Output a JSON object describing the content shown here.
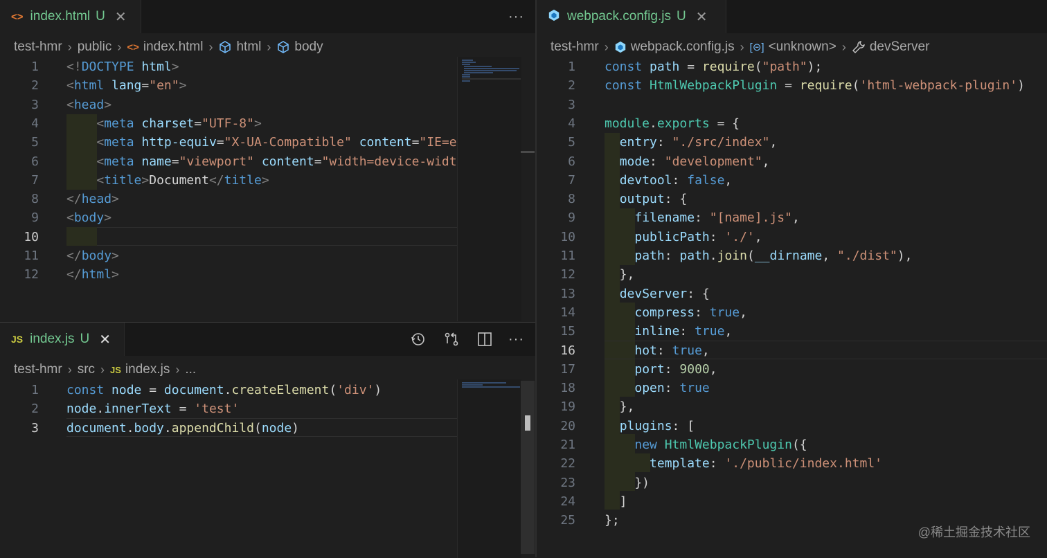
{
  "left_top": {
    "tab": {
      "icon": "<>",
      "label": "index.html",
      "status": "U"
    },
    "breadcrumb": [
      "test-hmr",
      "public",
      "index.html",
      "html",
      "body"
    ],
    "lines": [
      {
        "n": "1",
        "tokens": [
          [
            "t-punc",
            "<!"
          ],
          [
            "t-tag",
            "DOCTYPE"
          ],
          [
            "t-txt",
            " "
          ],
          [
            "t-attr",
            "html"
          ],
          [
            "t-punc",
            ">"
          ]
        ]
      },
      {
        "n": "2",
        "tokens": [
          [
            "t-punc",
            "<"
          ],
          [
            "t-tag",
            "html"
          ],
          [
            "t-txt",
            " "
          ],
          [
            "t-attr",
            "lang"
          ],
          [
            "t-txt",
            "="
          ],
          [
            "t-str",
            "\"en\""
          ],
          [
            "t-punc",
            ">"
          ]
        ]
      },
      {
        "n": "3",
        "tokens": [
          [
            "t-punc",
            "<"
          ],
          [
            "t-tag",
            "head"
          ],
          [
            "t-punc",
            ">"
          ]
        ]
      },
      {
        "n": "4",
        "tokens": [
          [
            "t-txt",
            "    "
          ],
          [
            "t-punc",
            "<"
          ],
          [
            "t-tag",
            "meta"
          ],
          [
            "t-txt",
            " "
          ],
          [
            "t-attr",
            "charset"
          ],
          [
            "t-txt",
            "="
          ],
          [
            "t-str",
            "\"UTF-8\""
          ],
          [
            "t-punc",
            ">"
          ]
        ]
      },
      {
        "n": "5",
        "tokens": [
          [
            "t-txt",
            "    "
          ],
          [
            "t-punc",
            "<"
          ],
          [
            "t-tag",
            "meta"
          ],
          [
            "t-txt",
            " "
          ],
          [
            "t-attr",
            "http-equiv"
          ],
          [
            "t-txt",
            "="
          ],
          [
            "t-str",
            "\"X-UA-Compatible\""
          ],
          [
            "t-txt",
            " "
          ],
          [
            "t-attr",
            "content"
          ],
          [
            "t-txt",
            "="
          ],
          [
            "t-str",
            "\"IE=e"
          ]
        ]
      },
      {
        "n": "6",
        "tokens": [
          [
            "t-txt",
            "    "
          ],
          [
            "t-punc",
            "<"
          ],
          [
            "t-tag",
            "meta"
          ],
          [
            "t-txt",
            " "
          ],
          [
            "t-attr",
            "name"
          ],
          [
            "t-txt",
            "="
          ],
          [
            "t-str",
            "\"viewport\""
          ],
          [
            "t-txt",
            " "
          ],
          [
            "t-attr",
            "content"
          ],
          [
            "t-txt",
            "="
          ],
          [
            "t-str",
            "\"width=device-widt"
          ]
        ]
      },
      {
        "n": "7",
        "tokens": [
          [
            "t-txt",
            "    "
          ],
          [
            "t-punc",
            "<"
          ],
          [
            "t-tag",
            "title"
          ],
          [
            "t-punc",
            ">"
          ],
          [
            "t-txt",
            "Document"
          ],
          [
            "t-punc",
            "</"
          ],
          [
            "t-tag",
            "title"
          ],
          [
            "t-punc",
            ">"
          ]
        ]
      },
      {
        "n": "8",
        "tokens": [
          [
            "t-punc",
            "</"
          ],
          [
            "t-tag",
            "head"
          ],
          [
            "t-punc",
            ">"
          ]
        ]
      },
      {
        "n": "9",
        "tokens": [
          [
            "t-punc",
            "<"
          ],
          [
            "t-tag",
            "body"
          ],
          [
            "t-punc",
            ">"
          ]
        ]
      },
      {
        "n": "10",
        "tokens": []
      },
      {
        "n": "11",
        "tokens": [
          [
            "t-punc",
            "</"
          ],
          [
            "t-tag",
            "body"
          ],
          [
            "t-punc",
            ">"
          ]
        ]
      },
      {
        "n": "12",
        "tokens": [
          [
            "t-punc",
            "</"
          ],
          [
            "t-tag",
            "html"
          ],
          [
            "t-punc",
            ">"
          ]
        ]
      }
    ],
    "active_line": "10"
  },
  "left_bottom": {
    "tab": {
      "icon": "JS",
      "label": "index.js",
      "status": "U"
    },
    "breadcrumb": [
      "test-hmr",
      "src",
      "index.js",
      "..."
    ],
    "lines": [
      {
        "n": "1",
        "tokens": [
          [
            "t-kw",
            "const"
          ],
          [
            "t-plain",
            " "
          ],
          [
            "t-var",
            "node"
          ],
          [
            "t-plain",
            " = "
          ],
          [
            "t-var",
            "document"
          ],
          [
            "t-plain",
            "."
          ],
          [
            "t-fn",
            "createElement"
          ],
          [
            "t-plain",
            "("
          ],
          [
            "t-str",
            "'div'"
          ],
          [
            "t-plain",
            ")"
          ]
        ]
      },
      {
        "n": "2",
        "tokens": [
          [
            "t-var",
            "node"
          ],
          [
            "t-plain",
            "."
          ],
          [
            "t-var",
            "innerText"
          ],
          [
            "t-plain",
            " = "
          ],
          [
            "t-str",
            "'test'"
          ]
        ]
      },
      {
        "n": "3",
        "tokens": [
          [
            "t-var",
            "document"
          ],
          [
            "t-plain",
            "."
          ],
          [
            "t-var",
            "body"
          ],
          [
            "t-plain",
            "."
          ],
          [
            "t-fn",
            "appendChild"
          ],
          [
            "t-plain",
            "("
          ],
          [
            "t-var",
            "node"
          ],
          [
            "t-plain",
            ")"
          ]
        ]
      }
    ],
    "active_line": "3"
  },
  "right": {
    "tab": {
      "icon": "webpack",
      "label": "webpack.config.js",
      "status": "U"
    },
    "breadcrumb": [
      "test-hmr",
      "webpack.config.js",
      "<unknown>",
      "devServer"
    ],
    "lines": [
      {
        "n": "1",
        "tokens": [
          [
            "t-kw",
            "const"
          ],
          [
            "t-plain",
            " "
          ],
          [
            "t-var",
            "path"
          ],
          [
            "t-plain",
            " = "
          ],
          [
            "t-fn",
            "require"
          ],
          [
            "t-plain",
            "("
          ],
          [
            "t-str",
            "\"path\""
          ],
          [
            "t-plain",
            ");"
          ]
        ]
      },
      {
        "n": "2",
        "tokens": [
          [
            "t-kw",
            "const"
          ],
          [
            "t-plain",
            " "
          ],
          [
            "t-cls",
            "HtmlWebpackPlugin"
          ],
          [
            "t-plain",
            " = "
          ],
          [
            "t-fn",
            "require"
          ],
          [
            "t-plain",
            "("
          ],
          [
            "t-str",
            "'html-webpack-plugin'"
          ],
          [
            "t-plain",
            ")"
          ]
        ]
      },
      {
        "n": "3",
        "tokens": []
      },
      {
        "n": "4",
        "tokens": [
          [
            "t-cls",
            "module"
          ],
          [
            "t-plain",
            "."
          ],
          [
            "t-cls",
            "exports"
          ],
          [
            "t-plain",
            " = {"
          ]
        ]
      },
      {
        "n": "5",
        "tokens": [
          [
            "t-plain",
            "  "
          ],
          [
            "t-var",
            "entry"
          ],
          [
            "t-plain",
            ": "
          ],
          [
            "t-str",
            "\"./src/index\""
          ],
          [
            "t-plain",
            ","
          ]
        ]
      },
      {
        "n": "6",
        "tokens": [
          [
            "t-plain",
            "  "
          ],
          [
            "t-var",
            "mode"
          ],
          [
            "t-plain",
            ": "
          ],
          [
            "t-str",
            "\"development\""
          ],
          [
            "t-plain",
            ","
          ]
        ]
      },
      {
        "n": "7",
        "tokens": [
          [
            "t-plain",
            "  "
          ],
          [
            "t-var",
            "devtool"
          ],
          [
            "t-plain",
            ": "
          ],
          [
            "t-bool",
            "false"
          ],
          [
            "t-plain",
            ","
          ]
        ]
      },
      {
        "n": "8",
        "tokens": [
          [
            "t-plain",
            "  "
          ],
          [
            "t-var",
            "output"
          ],
          [
            "t-plain",
            ": {"
          ]
        ]
      },
      {
        "n": "9",
        "tokens": [
          [
            "t-plain",
            "    "
          ],
          [
            "t-var",
            "filename"
          ],
          [
            "t-plain",
            ": "
          ],
          [
            "t-str",
            "\"[name].js\""
          ],
          [
            "t-plain",
            ","
          ]
        ]
      },
      {
        "n": "10",
        "tokens": [
          [
            "t-plain",
            "    "
          ],
          [
            "t-var",
            "publicPath"
          ],
          [
            "t-plain",
            ": "
          ],
          [
            "t-str",
            "'./'"
          ],
          [
            "t-plain",
            ","
          ]
        ]
      },
      {
        "n": "11",
        "tokens": [
          [
            "t-plain",
            "    "
          ],
          [
            "t-var",
            "path"
          ],
          [
            "t-plain",
            ": "
          ],
          [
            "t-var",
            "path"
          ],
          [
            "t-plain",
            "."
          ],
          [
            "t-fn",
            "join"
          ],
          [
            "t-plain",
            "("
          ],
          [
            "t-var",
            "__dirname"
          ],
          [
            "t-plain",
            ", "
          ],
          [
            "t-str",
            "\"./dist\""
          ],
          [
            "t-plain",
            "),"
          ]
        ]
      },
      {
        "n": "12",
        "tokens": [
          [
            "t-plain",
            "  },"
          ]
        ]
      },
      {
        "n": "13",
        "tokens": [
          [
            "t-plain",
            "  "
          ],
          [
            "t-var",
            "devServer"
          ],
          [
            "t-plain",
            ": {"
          ]
        ]
      },
      {
        "n": "14",
        "tokens": [
          [
            "t-plain",
            "    "
          ],
          [
            "t-var",
            "compress"
          ],
          [
            "t-plain",
            ": "
          ],
          [
            "t-bool",
            "true"
          ],
          [
            "t-plain",
            ","
          ]
        ]
      },
      {
        "n": "15",
        "tokens": [
          [
            "t-plain",
            "    "
          ],
          [
            "t-var",
            "inline"
          ],
          [
            "t-plain",
            ": "
          ],
          [
            "t-bool",
            "true"
          ],
          [
            "t-plain",
            ","
          ]
        ]
      },
      {
        "n": "16",
        "tokens": [
          [
            "t-plain",
            "    "
          ],
          [
            "t-var",
            "hot"
          ],
          [
            "t-plain",
            ": "
          ],
          [
            "t-bool",
            "true"
          ],
          [
            "t-plain",
            ","
          ]
        ]
      },
      {
        "n": "17",
        "tokens": [
          [
            "t-plain",
            "    "
          ],
          [
            "t-var",
            "port"
          ],
          [
            "t-plain",
            ": "
          ],
          [
            "t-num",
            "9000"
          ],
          [
            "t-plain",
            ","
          ]
        ]
      },
      {
        "n": "18",
        "tokens": [
          [
            "t-plain",
            "    "
          ],
          [
            "t-var",
            "open"
          ],
          [
            "t-plain",
            ": "
          ],
          [
            "t-bool",
            "true"
          ]
        ]
      },
      {
        "n": "19",
        "tokens": [
          [
            "t-plain",
            "  },"
          ]
        ]
      },
      {
        "n": "20",
        "tokens": [
          [
            "t-plain",
            "  "
          ],
          [
            "t-var",
            "plugins"
          ],
          [
            "t-plain",
            ": ["
          ]
        ]
      },
      {
        "n": "21",
        "tokens": [
          [
            "t-plain",
            "    "
          ],
          [
            "t-kw",
            "new"
          ],
          [
            "t-plain",
            " "
          ],
          [
            "t-cls",
            "HtmlWebpackPlugin"
          ],
          [
            "t-plain",
            "({"
          ]
        ]
      },
      {
        "n": "22",
        "tokens": [
          [
            "t-plain",
            "      "
          ],
          [
            "t-var",
            "template"
          ],
          [
            "t-plain",
            ": "
          ],
          [
            "t-str",
            "'./public/index.html'"
          ]
        ]
      },
      {
        "n": "23",
        "tokens": [
          [
            "t-plain",
            "    })"
          ]
        ]
      },
      {
        "n": "24",
        "tokens": [
          [
            "t-plain",
            "  ]"
          ]
        ]
      },
      {
        "n": "25",
        "tokens": [
          [
            "t-plain",
            "};"
          ]
        ]
      }
    ],
    "active_line": "16"
  },
  "watermark": "@稀土掘金技术社区",
  "colors": {
    "accent_modified": "#73c991",
    "background": "#1f1f1f"
  }
}
